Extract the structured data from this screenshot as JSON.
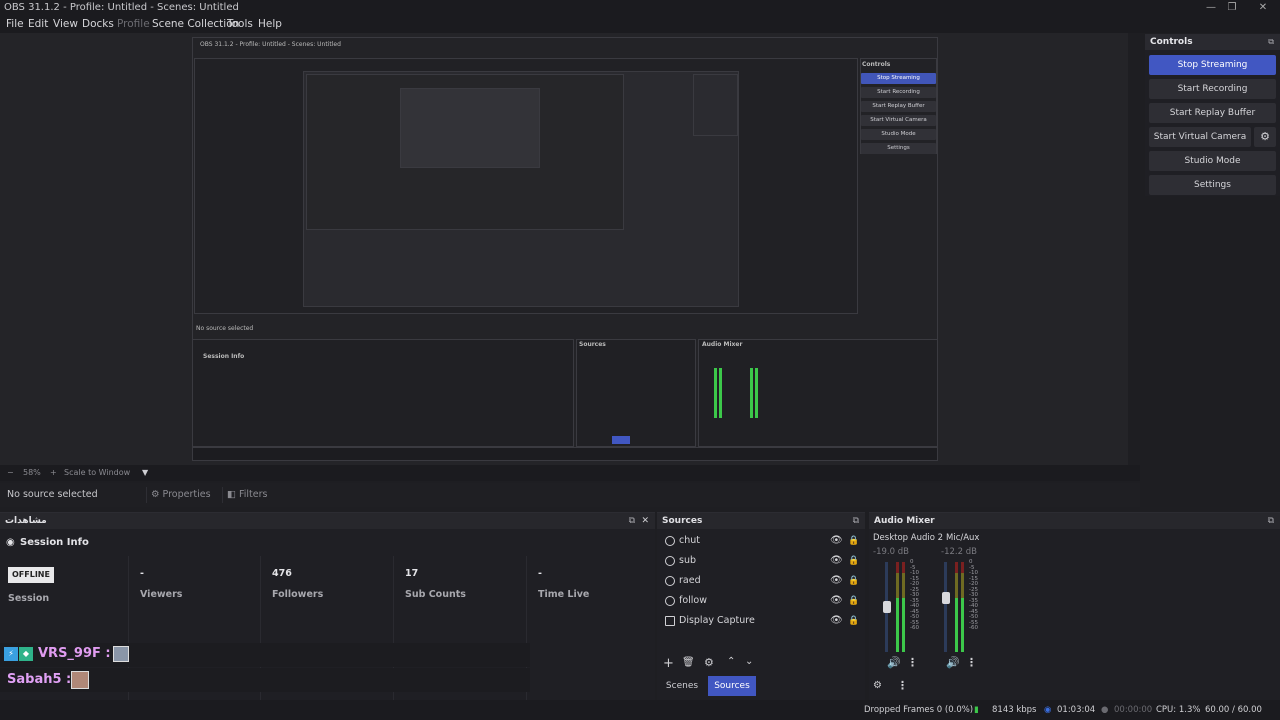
{
  "window": {
    "title": "OBS 31.1.2 - Profile: Untitled - Scenes: Untitled",
    "minimize": "—",
    "maximize": "❐",
    "close": "✕"
  },
  "menu": {
    "file": "File",
    "edit": "Edit",
    "view": "View",
    "docks": "Docks",
    "profile": "Profile",
    "scene_collection": "Scene Collection",
    "tools": "Tools",
    "help": "Help"
  },
  "preview": {
    "nested_title": "OBS 31.1.2 - Profile: Untitled - Scenes: Untitled",
    "nested_controls": [
      "Stop Streaming",
      "Start Recording",
      "Start Replay Buffer",
      "Start Virtual Camera",
      "Studio Mode",
      "Settings"
    ],
    "nested_controls_title": "Controls",
    "nested_no_source": "No source selected",
    "nested_session_info": "Session Info",
    "nested_sources_title": "Sources",
    "nested_audio_title": "Audio Mixer"
  },
  "zoom": {
    "minus": "−",
    "level": "58%",
    "plus": "+",
    "mode": "Scale to Window",
    "caret": "▼"
  },
  "source_toolbar": {
    "no_source": "No source selected",
    "properties": "Properties",
    "filters": "Filters"
  },
  "controls": {
    "title": "Controls",
    "stop_streaming": "Stop Streaming",
    "start_recording": "Start Recording",
    "start_replay_buffer": "Start Replay Buffer",
    "start_virtual_camera": "Start Virtual Camera",
    "studio_mode": "Studio Mode",
    "settings": "Settings"
  },
  "browser_dock": {
    "title": "مشاهدات",
    "session_info": "Session Info",
    "offline": "OFFLINE",
    "session_label": "Session",
    "stats": [
      {
        "value": "-",
        "label": "Viewers"
      },
      {
        "value": "476",
        "label": "Followers"
      },
      {
        "value": "17",
        "label": "Sub Counts"
      },
      {
        "value": "-",
        "label": "Time Live"
      }
    ],
    "chat": [
      {
        "name": "VRS_99F :",
        "color": "#e09cf0"
      },
      {
        "name": "Sabah5 :",
        "color": "#e0a0f4"
      }
    ]
  },
  "sources": {
    "title": "Sources",
    "items": [
      "chut",
      "sub",
      "raed",
      "follow",
      "Display Capture"
    ],
    "tab_scenes": "Scenes",
    "tab_sources": "Sources"
  },
  "audio": {
    "title": "Audio Mixer",
    "channels": [
      {
        "name": "Desktop Audio 2",
        "db": "-19.0 dB"
      },
      {
        "name": "Mic/Aux",
        "db": "-12.2 dB"
      }
    ],
    "scale": [
      "0",
      "-5",
      "-10",
      "-15",
      "-20",
      "-25",
      "-30",
      "-35",
      "-40",
      "-45",
      "-50",
      "-55",
      "-60"
    ]
  },
  "status": {
    "dropped_frames": "Dropped Frames 0 (0.0%)",
    "bitrate": "8143 kbps",
    "stream_time": "01:03:04",
    "rec_time": "00:00:00",
    "cpu": "CPU: 1.3%",
    "fps": "60.00 / 60.00 FPS"
  },
  "colors": {
    "accent": "#4157c2",
    "meter_green": "#3cc84a",
    "meter_yellow": "#c8c83c",
    "meter_red": "#c83c3c"
  }
}
